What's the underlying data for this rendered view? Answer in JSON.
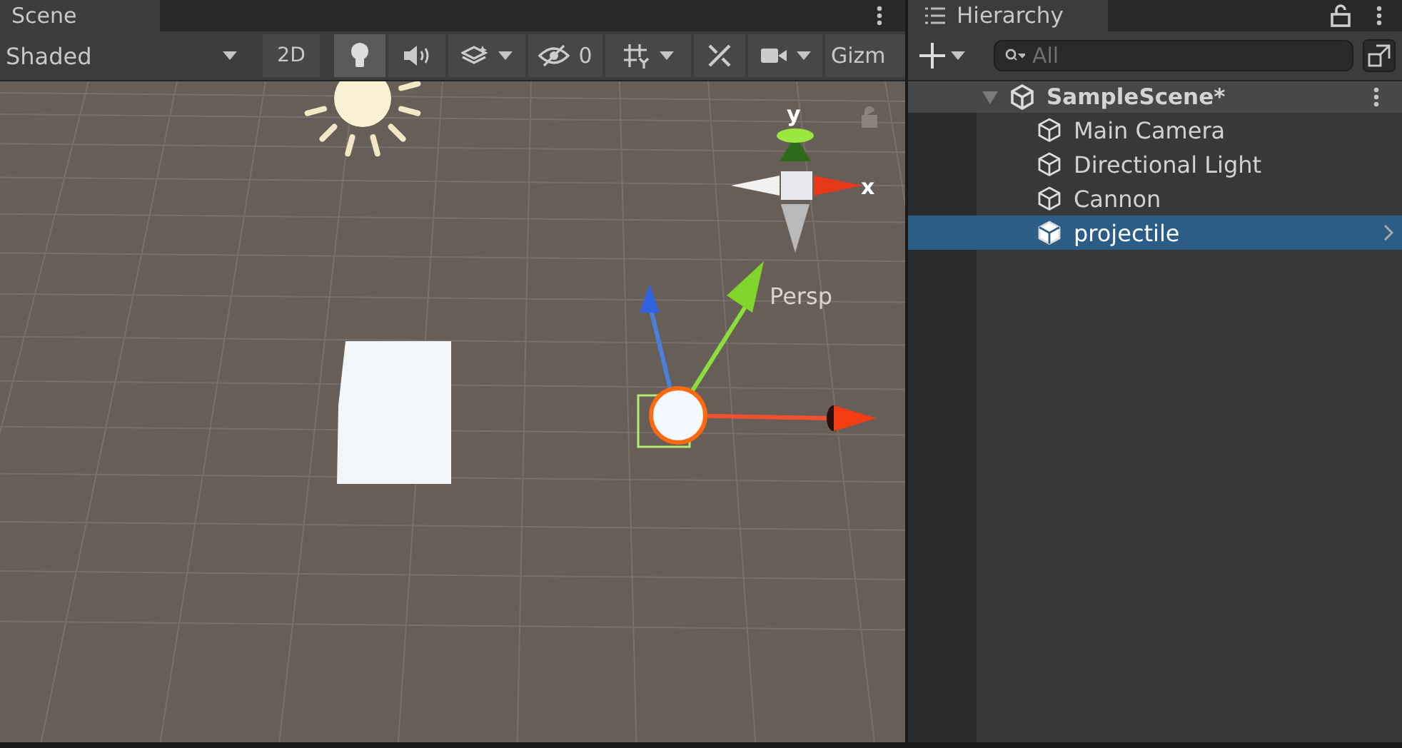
{
  "scene_view": {
    "tab": {
      "label": "Scene",
      "selected": true
    },
    "toolbar": {
      "shading_mode": "Shaded",
      "mode_2d": {
        "label": "2D",
        "on": false
      },
      "lighting": {
        "on": true
      },
      "audio": {
        "on": false
      },
      "hidden_count": "0",
      "gizmos": "Gizm"
    },
    "axis_labels": {
      "y": "y",
      "x": "x",
      "projection": "Persp"
    }
  },
  "hierarchy": {
    "tab": {
      "label": "Hierarchy",
      "selected": true
    },
    "search": {
      "placeholder": "All"
    },
    "scene": {
      "name": "SampleScene*",
      "expanded": true,
      "children": [
        {
          "name": "Main Camera",
          "selected": false
        },
        {
          "name": "Directional Light",
          "selected": false
        },
        {
          "name": "Cannon",
          "selected": false
        },
        {
          "name": "projectile",
          "selected": true
        }
      ]
    }
  }
}
